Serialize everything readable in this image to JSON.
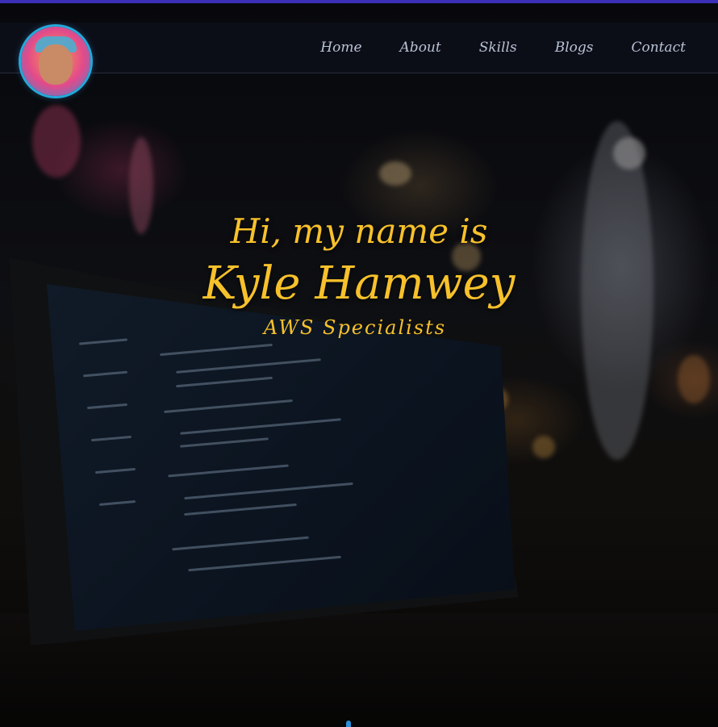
{
  "nav": {
    "logo_alt": "Kyle Hamwey avatar",
    "links": [
      "Home",
      "About",
      "Skills",
      "Blogs",
      "Contact"
    ]
  },
  "hero": {
    "greeting": "Hi, my name is",
    "name": "Kyle Hamwey",
    "role": "AWS Specialists"
  },
  "colors": {
    "accent_text": "#f7c12b",
    "nav_text": "#b9c2d6",
    "top_bar": "#3b2fb8",
    "logo_ring": "#23a9d9"
  }
}
